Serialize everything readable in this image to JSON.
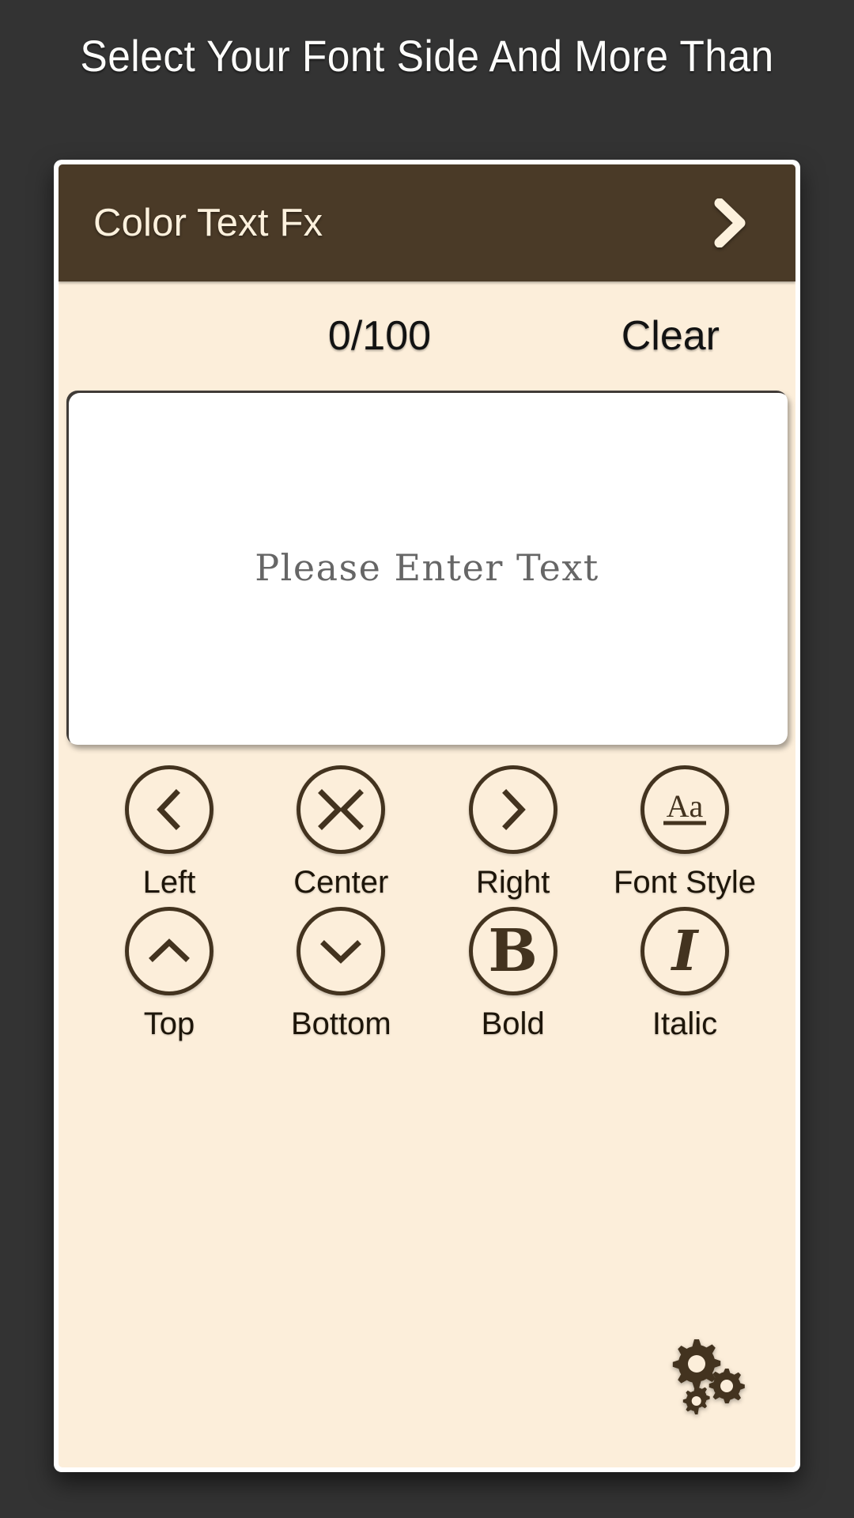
{
  "page": {
    "title": "Select Your Font Side And More Than",
    "background_color": "#333333"
  },
  "appbar": {
    "title": "Color Text Fx",
    "background_color": "#4a3a27",
    "text_color": "#fdf1dd",
    "chevron_icon": "chevron-right-icon"
  },
  "editor": {
    "counter": "0/100",
    "clear_label": "Clear",
    "placeholder": "Please Enter Text",
    "value": "",
    "panel_color": "#fceeda",
    "field_color": "#ffffff"
  },
  "tools": {
    "accent_color": "#43331f",
    "rows": [
      [
        {
          "label": "Left",
          "icon": "chevron-left-icon"
        },
        {
          "label": "Center",
          "icon": "align-center-icon"
        },
        {
          "label": "Right",
          "icon": "chevron-right-icon"
        },
        {
          "label": "Font Style",
          "icon": "font-style-aa-icon"
        }
      ],
      [
        {
          "label": "Top",
          "icon": "chevron-up-icon"
        },
        {
          "label": "Bottom",
          "icon": "chevron-down-icon"
        },
        {
          "label": "Bold",
          "icon": "bold-b-icon",
          "glyph": "B"
        },
        {
          "label": "Italic",
          "icon": "italic-i-icon",
          "glyph": "I"
        }
      ]
    ]
  },
  "settings": {
    "icon": "gears-settings-icon",
    "color": "#43331f"
  }
}
